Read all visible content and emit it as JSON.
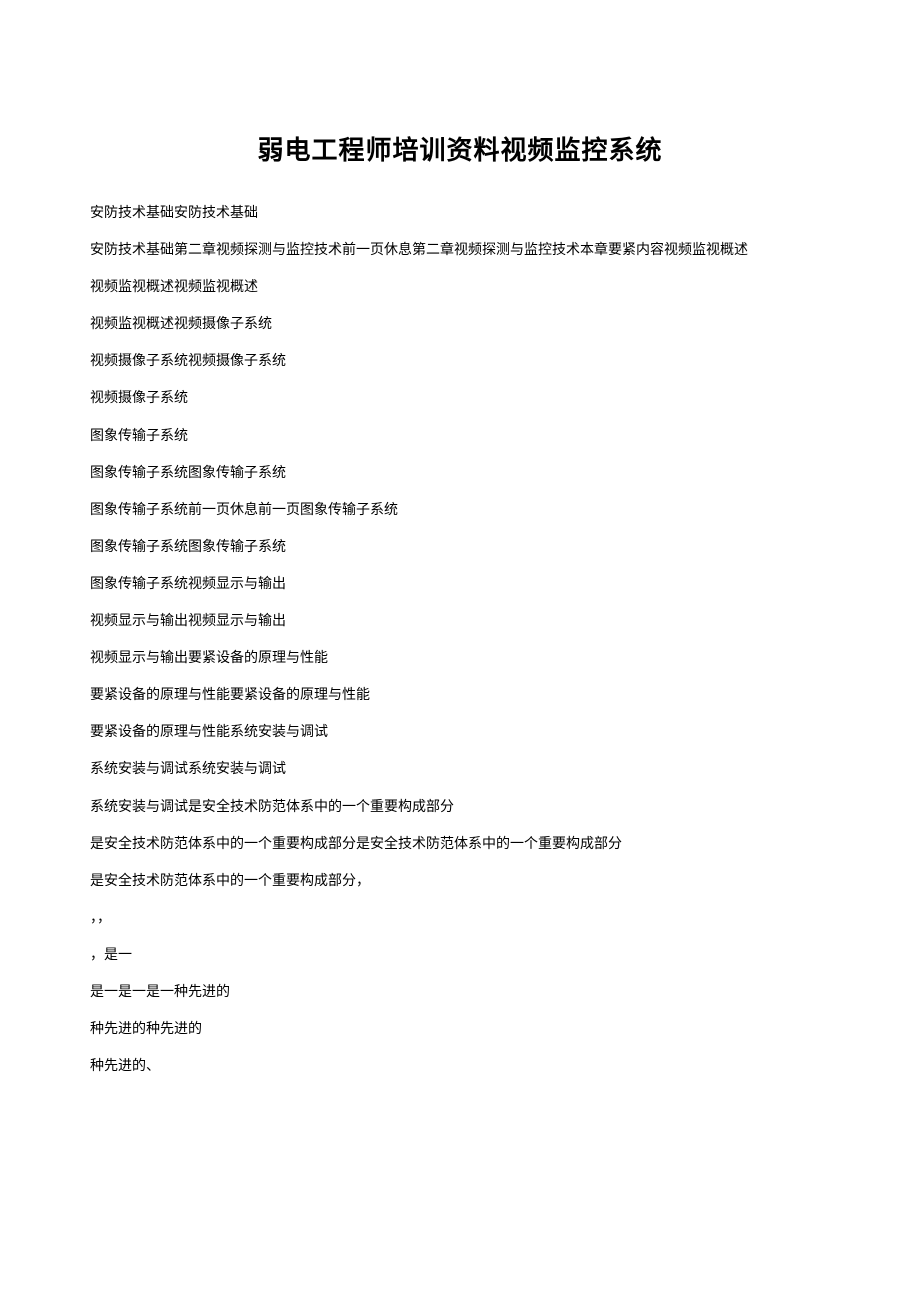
{
  "title": "弱电工程师培训资料视频监控系统",
  "paragraphs": [
    "安防技术基础安防技术基础",
    "安防技术基础第二章视频探测与监控技术前一页休息第二章视频探测与监控技术本章要紧内容视频监视概述",
    "视频监视概述视频监视概述",
    "视频监视概述视频摄像子系统",
    "视频摄像子系统视频摄像子系统",
    "视频摄像子系统",
    "图象传输子系统",
    "图象传输子系统图象传输子系统",
    "图象传输子系统前一页休息前一页图象传输子系统",
    "图象传输子系统图象传输子系统",
    "图象传输子系统视频显示与输出",
    "视频显示与输出视频显示与输出",
    "视频显示与输出要紧设备的原理与性能",
    "要紧设备的原理与性能要紧设备的原理与性能",
    "要紧设备的原理与性能系统安装与调试",
    "系统安装与调试系统安装与调试",
    "系统安装与调试是安全技术防范体系中的一个重要构成部分",
    "是安全技术防范体系中的一个重要构成部分是安全技术防范体系中的一个重要构成部分",
    "是安全技术防范体系中的一个重要构成部分，",
    "，，",
    "，是一",
    "是一是一是一种先进的",
    "种先进的种先进的",
    "种先进的、"
  ]
}
